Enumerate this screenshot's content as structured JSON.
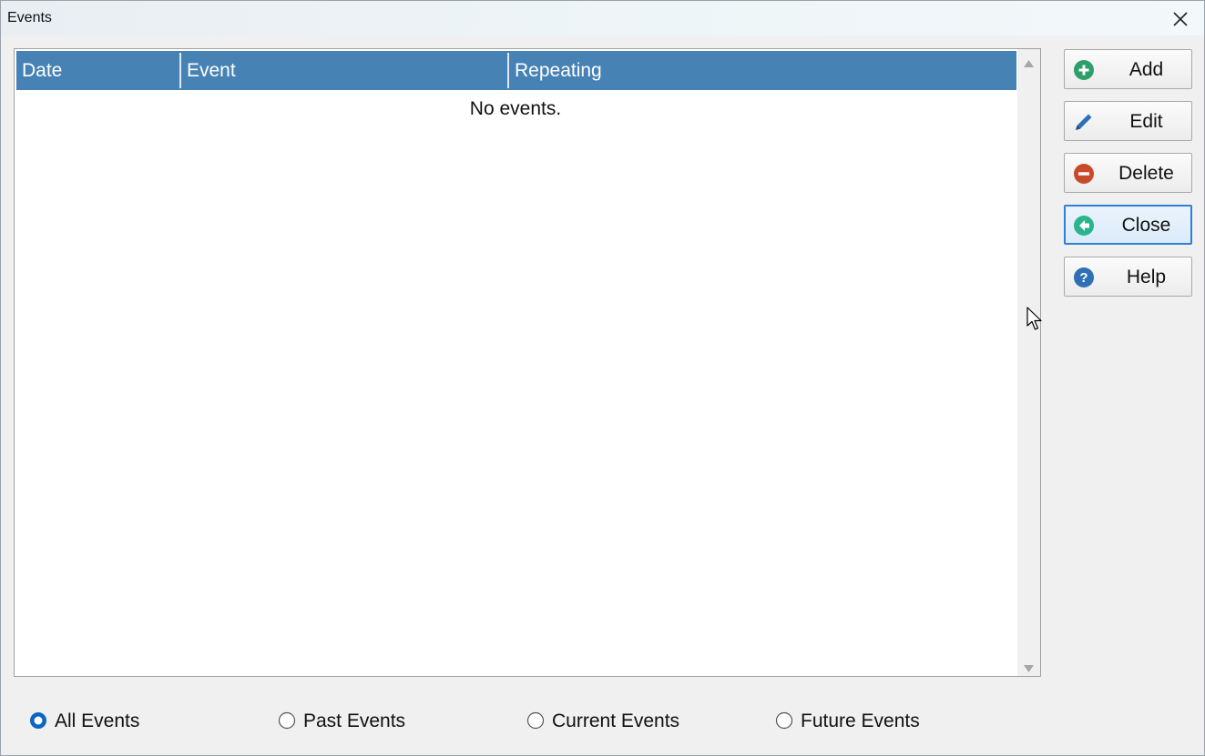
{
  "window": {
    "title": "Events"
  },
  "table": {
    "columns": [
      "Date",
      "Event",
      "Repeating"
    ],
    "empty_message": "No events."
  },
  "buttons": {
    "add": "Add",
    "edit": "Edit",
    "delete": "Delete",
    "close": "Close",
    "help": "Help"
  },
  "filter": {
    "options": [
      "All Events",
      "Past Events",
      "Current Events",
      "Future Events"
    ],
    "selected": "All Events"
  },
  "colors": {
    "header_bg": "#4682b4",
    "add_icon": "#2e9e6a",
    "edit_icon": "#2f6fb5",
    "delete_icon": "#c94a2a",
    "close_icon": "#2ab58a",
    "help_icon": "#2f6fb5",
    "radio_selected": "#0a66c2"
  }
}
